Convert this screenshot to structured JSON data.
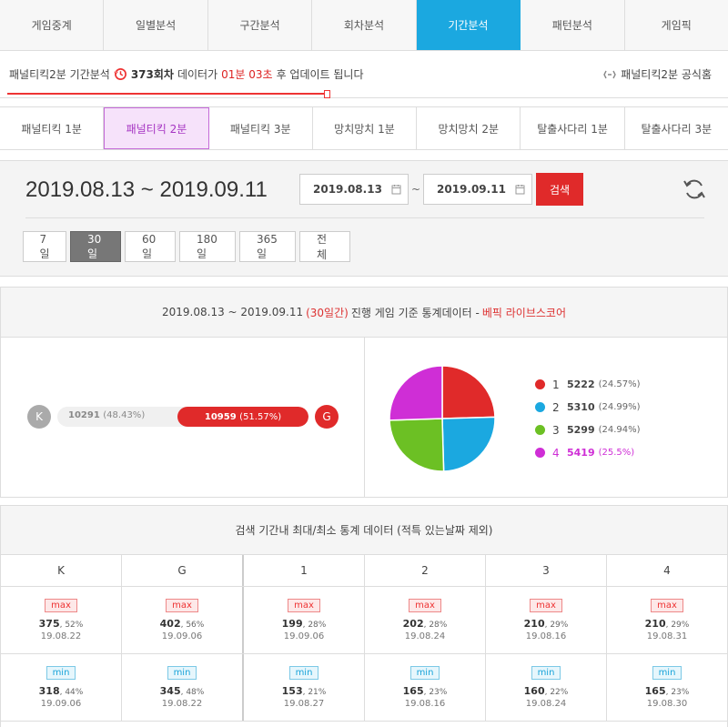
{
  "top_tabs": [
    "게임중계",
    "일별분석",
    "구간분석",
    "회차분석",
    "기간분석",
    "패턴분석",
    "게임픽"
  ],
  "top_active": 4,
  "info": {
    "prefix": "패널티킥2분 기간분석",
    "round": "373회차",
    "mid": "데이터가",
    "time": "01분 03초",
    "suffix": "후 업데이트 됩니다",
    "home_label": "패널티킥2분 공식홈"
  },
  "sub_tabs": [
    "패널티킥 1분",
    "패널티킥 2분",
    "패널티킥 3분",
    "망치망치 1분",
    "망치망치 2분",
    "탈출사다리 1분",
    "탈출사다리 3분"
  ],
  "sub_active": 1,
  "date": {
    "range_title": "2019.08.13 ~ 2019.09.11",
    "start": "2019.08.13",
    "end": "2019.09.11",
    "tilde": "~",
    "search_label": "검색"
  },
  "periods": [
    "7일",
    "30일",
    "60일",
    "180일",
    "365일",
    "전체"
  ],
  "period_active": 1,
  "stats": {
    "range": "2019.08.13 ~ 2019.09.11",
    "days": "(30일간)",
    "desc": "진행 게임 기준 통계데이터 -",
    "source": "베픽 라이브스코어",
    "k_label": "K",
    "g_label": "G",
    "k_value": "10291",
    "k_pct": "(48.43%)",
    "g_value": "10959",
    "g_pct": "(51.57%)",
    "g_fraction": 0.5157
  },
  "pie": [
    {
      "label": "1",
      "value": "5222",
      "pct": "(24.57%)",
      "fraction": 0.2457,
      "color": "#e02a2a"
    },
    {
      "label": "2",
      "value": "5310",
      "pct": "(24.99%)",
      "fraction": 0.2499,
      "color": "#1ba8e0"
    },
    {
      "label": "3",
      "value": "5299",
      "pct": "(24.94%)",
      "fraction": 0.2494,
      "color": "#6cc024"
    },
    {
      "label": "4",
      "value": "5419",
      "pct": "(25.5%)",
      "fraction": 0.255,
      "color": "#cf2ed6"
    }
  ],
  "table": {
    "title": "검색 기간내 최대/최소 통계 데이터 (적특 있는날짜 제외)",
    "columns": [
      "K",
      "G",
      "1",
      "2",
      "3",
      "4"
    ],
    "max_label": "max",
    "min_label": "min",
    "max_row": [
      {
        "v": "375",
        "p": ", 52%",
        "d": "19.08.22"
      },
      {
        "v": "402",
        "p": ", 56%",
        "d": "19.09.06"
      },
      {
        "v": "199",
        "p": ", 28%",
        "d": "19.09.06"
      },
      {
        "v": "202",
        "p": ", 28%",
        "d": "19.08.24"
      },
      {
        "v": "210",
        "p": ", 29%",
        "d": "19.08.16"
      },
      {
        "v": "210",
        "p": ", 29%",
        "d": "19.08.31"
      }
    ],
    "min_row": [
      {
        "v": "318",
        "p": ", 44%",
        "d": "19.09.06"
      },
      {
        "v": "345",
        "p": ", 48%",
        "d": "19.08.22"
      },
      {
        "v": "153",
        "p": ", 21%",
        "d": "19.08.27"
      },
      {
        "v": "165",
        "p": ", 23%",
        "d": "19.08.16"
      },
      {
        "v": "160",
        "p": ", 22%",
        "d": "19.08.24"
      },
      {
        "v": "165",
        "p": ", 23%",
        "d": "19.08.30"
      }
    ]
  }
}
